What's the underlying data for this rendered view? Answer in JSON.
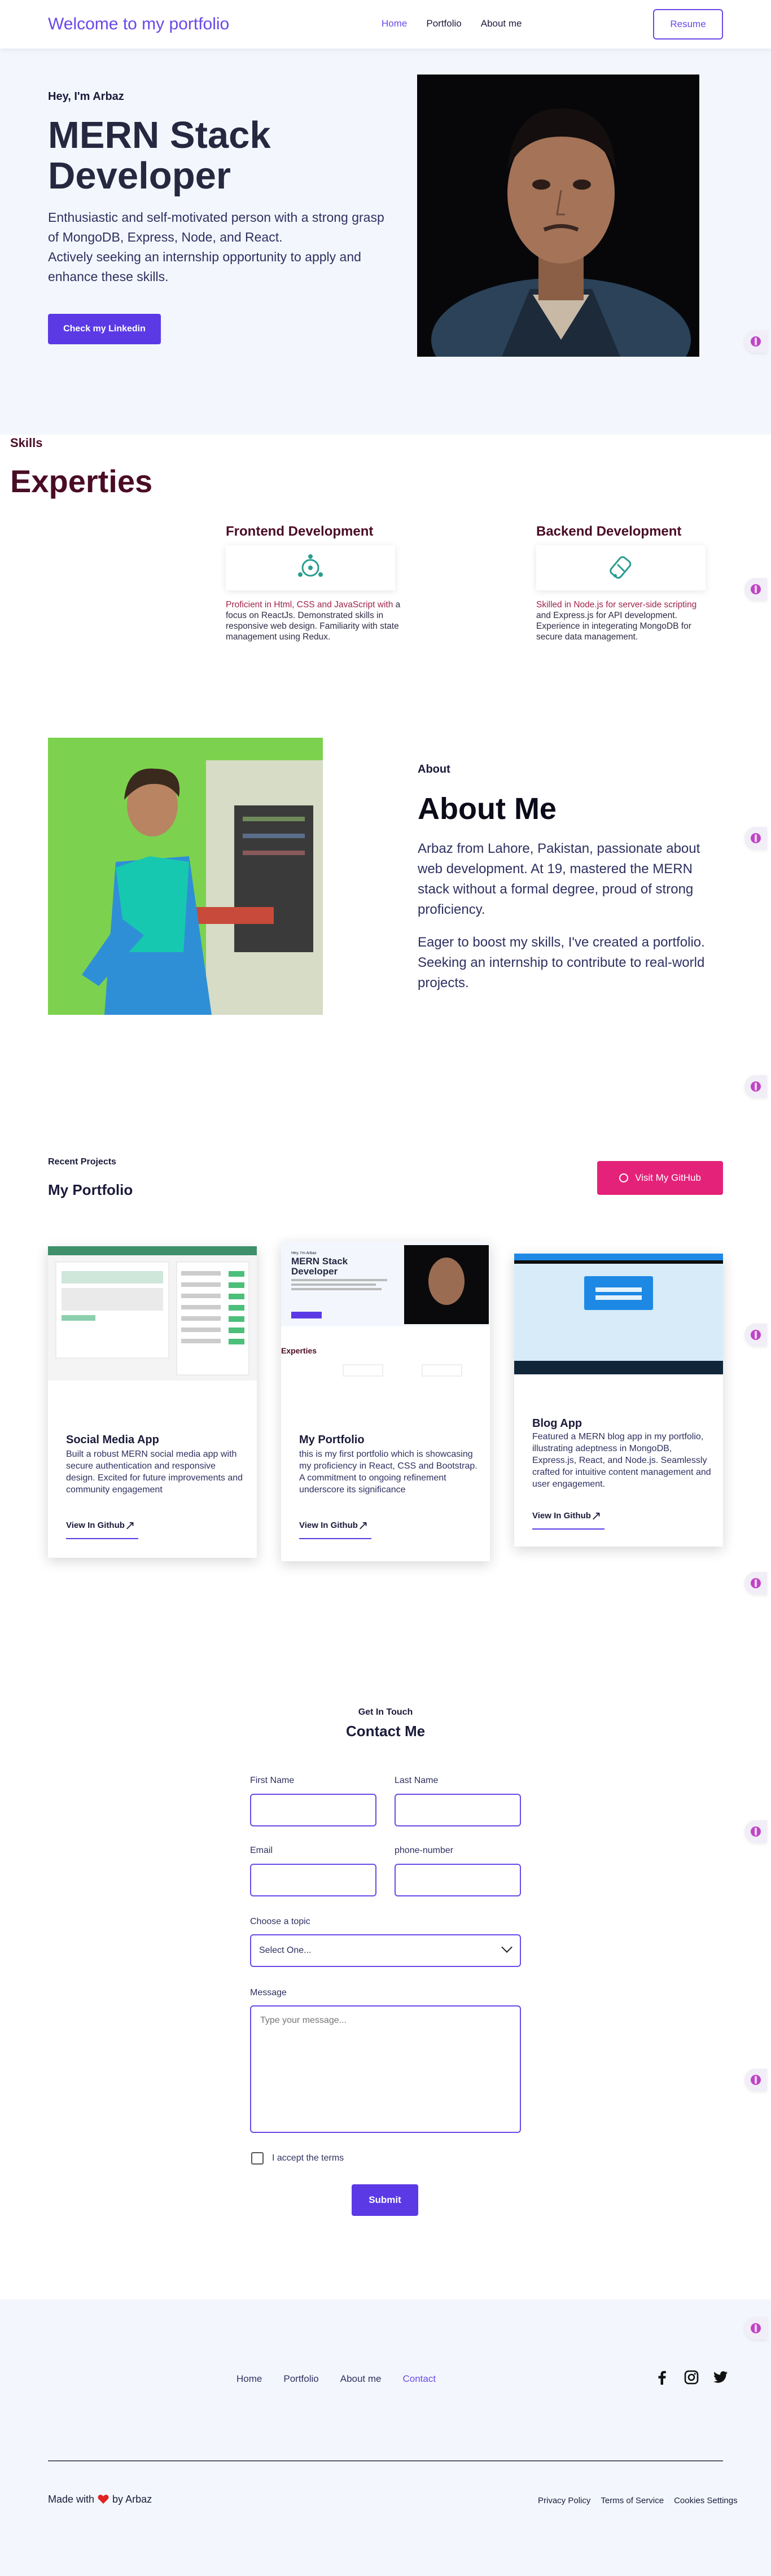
{
  "nav": {
    "brand": "Welcome to my portfolio",
    "links": [
      "Home",
      "Portfolio",
      "About me"
    ],
    "resume": "Resume"
  },
  "hero": {
    "greeting": "Hey, I'm Arbaz",
    "title": "MERN Stack Developer",
    "desc1": "Enthusiastic and self-motivated person with a strong grasp of MongoDB, Express, Node, and React.",
    "desc2": "Actively seeking an internship opportunity to apply and enhance these skills.",
    "button": "Check my Linkedin"
  },
  "skills": {
    "label": "Skills",
    "title": "Experties",
    "items": [
      {
        "title": "Frontend Development",
        "highlight": "Proficient in Html, CSS and JavaScript with",
        "rest": "a focus on ReactJs. Demonstrated skills in responsive web design. Familiarity with state management using Redux.",
        "icon": "react-icon"
      },
      {
        "title": "Backend Development",
        "highlight": "Skilled in Node.js for server-side scripting",
        "rest": "and Express.js for API development. Experience in integerating MongoDB for secure data management.",
        "icon": "mongodb-icon"
      }
    ]
  },
  "about": {
    "label": "About",
    "title": "About Me",
    "p1": "Arbaz from Lahore, Pakistan, passionate about web development. At 19, mastered the MERN stack without a formal degree, proud of strong proficiency.",
    "p2": "Eager to boost my skills, I've created a portfolio. Seeking an internship to contribute to real-world projects."
  },
  "portfolio": {
    "label": "Recent Projects",
    "title": "My Portfolio",
    "github_button": "Visit My GitHub",
    "projects": [
      {
        "title": "Social Media App",
        "desc": "Built a robust MERN social media app with secure authentication and responsive design. Excited for future improvements and community engagement",
        "link": "View In Github"
      },
      {
        "title": "My Portfolio",
        "desc": "this is my first portfolio which is showcasing my proficiency in React, CSS and Bootstrap. A commitment to ongoing refinement underscore its significance",
        "link": "View In Github"
      },
      {
        "title": "Blog App",
        "desc": "Featured a MERN blog app in my portfolio, illustrating adeptness in MongoDB, Express.js, React, and Node.js. Seamlessly crafted for intuitive content management and user engagement.",
        "link": "View In Github"
      }
    ]
  },
  "contact": {
    "label": "Get In Touch",
    "title": "Contact Me",
    "first_name": "First Name",
    "last_name": "Last Name",
    "email": "Email",
    "phone": "phone-number",
    "topic_label": "Choose a topic",
    "topic_value": "Select One...",
    "message_label": "Message",
    "message_placeholder": "Type your message...",
    "terms": "I accept the terms",
    "submit": "Submit"
  },
  "footer": {
    "links": [
      "Home",
      "Portfolio",
      "About me",
      "Contact"
    ],
    "made_prefix": "Made with",
    "made_suffix": "by Arbaz",
    "legal": [
      "Privacy Policy",
      "Terms of Service",
      "Cookies Settings"
    ]
  },
  "colors": {
    "accent": "#6a48e8",
    "primary_button": "#5b3ae6",
    "github_button": "#e5227a",
    "skills_heading": "#4a0c25",
    "hero_background": "#f3f7fd"
  }
}
